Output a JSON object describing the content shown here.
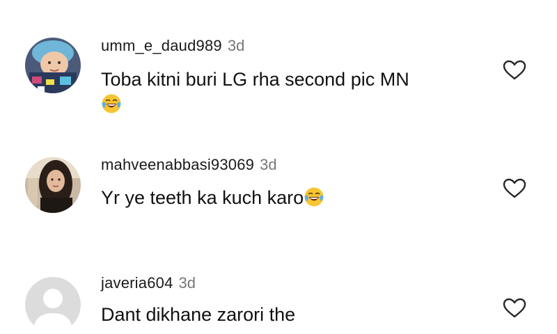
{
  "comments": [
    {
      "username": "umm_e_daud989",
      "time": "3d",
      "text": "Toba kitni buri LG rha second pic MN",
      "emoji": "😂",
      "avatar_icon": "baby-profile-photo",
      "like_icon": "heart-outline-icon"
    },
    {
      "username": "mahveenabbasi93069",
      "time": "3d",
      "text": "Yr ye teeth ka kuch karo",
      "emoji": "😂",
      "avatar_icon": "woman-profile-photo",
      "like_icon": "heart-outline-icon"
    },
    {
      "username": "javeria604",
      "time": "3d",
      "text": "Dant dikhane zarori the",
      "avatar_icon": "default-avatar-icon",
      "like_icon": "heart-outline-icon"
    }
  ],
  "colors": {
    "background": "#ffffff",
    "text": "#111111",
    "timestamp": "#777777",
    "default_avatar": "#d9d9d9"
  }
}
